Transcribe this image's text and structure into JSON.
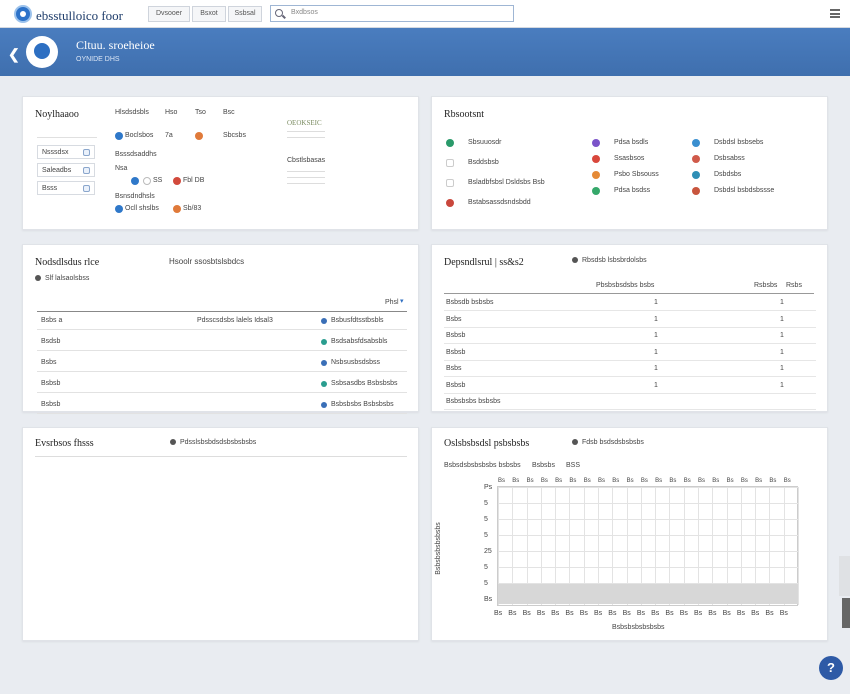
{
  "topbar": {
    "app_name": "ebsstulloico foor",
    "nav": [
      "Dvsooer",
      "Bsxot",
      "Ssbsal"
    ],
    "search_placeholder": "Bxdbsos"
  },
  "header": {
    "title": "Cltuu. sroeheioe",
    "subtitle": "OYNIDE DHS"
  },
  "panel_notifications": {
    "title": "Noylhaaoo",
    "fields": [
      "Nsssdsx",
      "Saleadbs",
      "Bsss"
    ],
    "col_labels": [
      "Hlsdsdsbls",
      "Hso",
      "Tso",
      "Bsc"
    ],
    "row1": {
      "a": "Boclsbos",
      "b": "7a",
      "c": "Sbcsbs"
    },
    "section2": "Bsssdsaddhs",
    "row2": {
      "a": "Nsa",
      "b": "SS",
      "c": "Fbl DB"
    },
    "section3": "Bsnsdndhsls",
    "row3": {
      "a": "Ocll shslbs",
      "b": "Sb/83"
    },
    "side1": "OEOKSEIC",
    "side2": "Cbstlsbasas"
  },
  "panel_resources": {
    "title": "Rbsootsnt",
    "col1": [
      "Sbsuuosdr",
      "Bsddsbsb",
      "Bsladbfsbsl Dsldsbs Bsb",
      "Bstabsassdsndsbdd"
    ],
    "col2": [
      "Pdsa bsdls",
      "Ssasbsos",
      "Psbo Sbsouss",
      "Pdsa bsdss"
    ],
    "col3": [
      "Dsbdsl bsbsebs",
      "Dsbsabss",
      "Dsbdsbs",
      "Dsbdsl bsbdsbssse"
    ],
    "col2_colors": [
      "#7b53c9",
      "#d9473c",
      "#e58a36",
      "#35a86a"
    ],
    "col3_colors": [
      "#3a8fd0",
      "#d05a4a",
      "#2f8fb6",
      "#c8553d"
    ]
  },
  "panel_notesbilities": {
    "title": "Nodsdlsdus rlce",
    "subtitle": "Hsoolr ssosbtslsbdcs",
    "sub_label": "Slf lalsaolsbss",
    "page_ctrl": "Phsl",
    "rows": [
      {
        "name": "Bsbs a",
        "mid": "Pdsscsdsbs lalels Idsal3",
        "status": "Bsbusfdtsstbsbls"
      },
      {
        "name": "Bsdsb",
        "mid": "",
        "status": "Bsdsabsfdsabsbls"
      },
      {
        "name": "Bsbs",
        "mid": "",
        "status": "Nsbsusbsdsbss"
      },
      {
        "name": "Bsbsb",
        "mid": "",
        "status": "Ssbsasdbs Bsbsbsbs"
      },
      {
        "name": "Bsbsb",
        "mid": "",
        "status": "Bsbsbsbs Bsbsbsbs"
      }
    ]
  },
  "panel_dependencies": {
    "title": "Depsndlsrul | ss&s2",
    "link": "Rbsdsb lsbsbrdolsbs",
    "headers": [
      "Pbsbsbsdsbs bsbs",
      "Rsbsbs",
      "Rsbs"
    ],
    "rows": [
      {
        "name": "Bsbsdb bsbsbs",
        "v": "1"
      },
      {
        "name": "Bsbs",
        "v": "1"
      },
      {
        "name": "Bsbsb",
        "v": "1"
      },
      {
        "name": "Bsbsb",
        "v": "1"
      },
      {
        "name": "Bsbs",
        "v": "1"
      },
      {
        "name": "Bsbsb",
        "v": "1"
      },
      {
        "name": "Bsbsbsbs bsbsbs",
        "v": ""
      }
    ]
  },
  "panel_events": {
    "title": "Evsrbsos fhsss",
    "link": "Pdsslsbsbdsdsbsbsbsbs"
  },
  "panel_chart": {
    "title": "Oslsbsbsdsl psbsbsbs",
    "link": "Fdsb bsdsdsbsbsbs",
    "meta": [
      "Bsbsdsbsbsbsbs bsbsbs",
      "Bsbsbs",
      "BSS"
    ],
    "ylabel": "Bsbsbsbsbsbsbs",
    "xlabel": "Bsbsbsbsbsbsbs",
    "ytick_labels": [
      "Ps",
      "5",
      "5",
      "5",
      "25",
      "5",
      "5",
      "Bs"
    ],
    "xtick_labels": [
      "Bs",
      "Bs",
      "Bs",
      "Bs",
      "Bs",
      "Bs",
      "Bs",
      "Bs",
      "Bs",
      "Bs",
      "Bs",
      "Bs",
      "Bs",
      "Bs",
      "Bs",
      "Bs",
      "Bs",
      "Bs",
      "Bs",
      "Bs",
      "Bs"
    ],
    "band_color": "#d7d7d7"
  },
  "help": "?"
}
